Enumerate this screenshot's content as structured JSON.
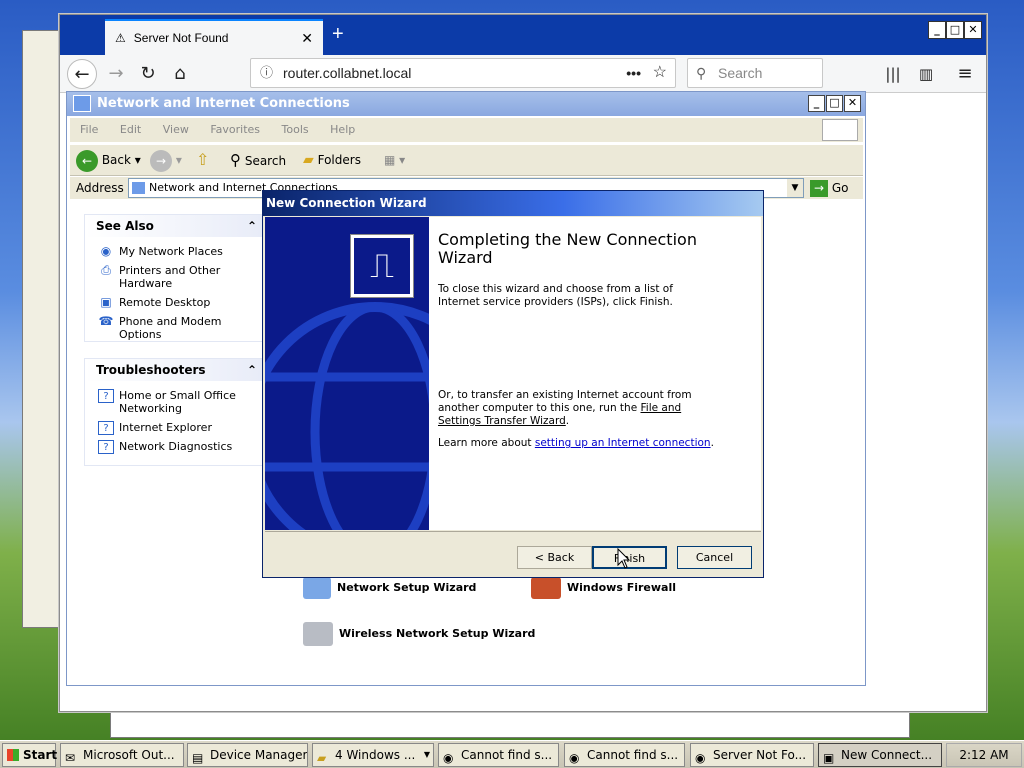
{
  "browser": {
    "tab_title": "Server Not Found",
    "new_tab_label": "+",
    "url_text": "router.collabnet.local",
    "search_placeholder": "Search"
  },
  "explorer": {
    "title": "Network and Internet Connections",
    "menu": [
      "File",
      "Edit",
      "View",
      "Favorites",
      "Tools",
      "Help"
    ],
    "toolbar": {
      "back": "Back",
      "search": "Search",
      "folders": "Folders"
    },
    "address_label": "Address",
    "address_value": "Network and Internet Connections",
    "go_label": "Go",
    "see_also": {
      "title": "See Also",
      "items": [
        "My Network Places",
        "Printers and Other Hardware",
        "Remote Desktop",
        "Phone and Modem Options"
      ]
    },
    "troubleshooters": {
      "title": "Troubleshooters",
      "items": [
        "Home or Small Office Networking",
        "Internet Explorer",
        "Network Diagnostics"
      ]
    },
    "icons": [
      "Network Setup Wizard",
      "Windows Firewall",
      "Wireless Network Setup Wizard"
    ]
  },
  "wizard": {
    "title": "New Connection Wizard",
    "heading": "Completing the New Connection Wizard",
    "para1": "To close this wizard and choose from a list of Internet service providers (ISPs), click Finish.",
    "para2_pre": "Or, to transfer an existing Internet account from another computer to this one, run the ",
    "para2_link": "File and Settings Transfer Wizard",
    "para2_post": ".",
    "para3_pre": "Learn more about ",
    "para3_link": "setting up an Internet connection",
    "para3_post": ".",
    "back_label": "< Back",
    "finish_label": "Finish",
    "cancel_label": "Cancel"
  },
  "taskbar": {
    "start_label": "Start",
    "tasks": [
      "Microsoft Out...",
      "Device Manager",
      "4 Windows ...",
      "Cannot find s...",
      "Cannot find s...",
      "Server Not Fo...",
      "New Connect..."
    ],
    "clock": "2:12 AM"
  },
  "colors": {
    "xp_blue": "#0a246a",
    "firefox_accent": "#0a84ff",
    "link": "#0000cc"
  }
}
